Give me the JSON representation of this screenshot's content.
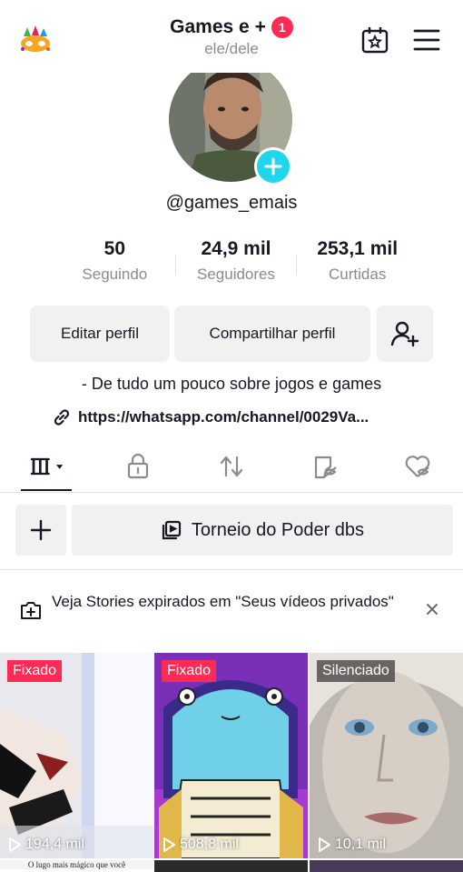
{
  "header": {
    "title": "Games e +",
    "notification_count": "1",
    "pronouns": "ele/dele",
    "icons": [
      "party-mask-icon",
      "calendar-star-icon",
      "menu-icon"
    ]
  },
  "profile": {
    "username": "@games_emais",
    "stats": [
      {
        "value": "50",
        "label": "Seguindo"
      },
      {
        "value": "24,9 mil",
        "label": "Seguidores"
      },
      {
        "value": "253,1 mil",
        "label": "Curtidas"
      }
    ],
    "buttons": {
      "edit": "Editar perfil",
      "share": "Compartilhar perfil"
    },
    "bio": "- De tudo um pouco sobre jogos e games",
    "link": "https://whatsapp.com/channel/0029Va..."
  },
  "tabs": [
    "videos-grid-tab",
    "private-tab",
    "reposts-tab",
    "favorites-tab",
    "liked-tab"
  ],
  "playlist": {
    "name": "Torneio do Poder dbs"
  },
  "notice": {
    "text": "Veja Stories expirados em \"Seus vídeos privados\""
  },
  "videos": [
    {
      "tag": "Fixado",
      "views": "194,4 mil"
    },
    {
      "tag": "Fixado",
      "views": "508,8 mil"
    },
    {
      "tag": "Silenciado",
      "views": "10,1 mil"
    }
  ],
  "row2": {
    "caption": "O lugo mais mágico que você"
  },
  "colors": {
    "accent": "#fe2c55",
    "cyan": "#20d5ec",
    "text": "#161823",
    "muted": "#8a8b91",
    "button_bg": "#f1f1f2"
  }
}
